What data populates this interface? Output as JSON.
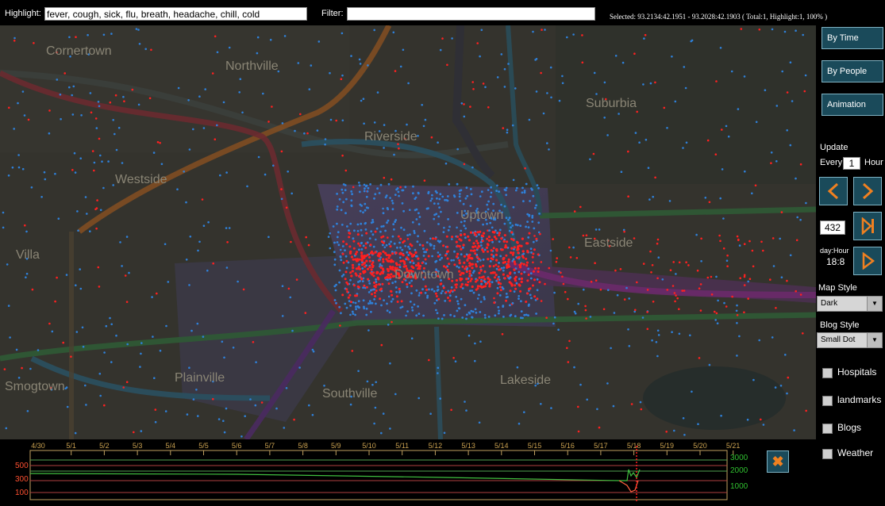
{
  "toolbar": {
    "highlight_label": "Highlight:",
    "highlight_value": "fever, cough, sick, flu, breath, headache, chill, cold",
    "filter_label": "Filter:",
    "filter_value": "",
    "selected_text": "Selected: 93.2134:42.1951 - 93.2028:42.1903 ( Total:1, Highlight:1, 100% )"
  },
  "map": {
    "areas": [
      "Cornertown",
      "Northville",
      "Suburbia",
      "Riverside",
      "Westside",
      "Uptown",
      "Eastside",
      "Villa",
      "Downtown",
      "Plainville",
      "Southville",
      "Lakeside",
      "Smogtown"
    ]
  },
  "side": {
    "by_time": "By Time",
    "by_people": "By People",
    "animation": "Animation",
    "update_label": "Update",
    "every_label": "Every",
    "every_value": "1",
    "hour_label": "Hour",
    "counter_value": "432",
    "day_hour_label": "day:Hour",
    "day_hour_value": "18:8",
    "map_style_label": "Map Style",
    "map_style_value": "Dark",
    "blog_style_label": "Blog Style",
    "blog_style_value": "Small Dot",
    "layers": [
      "Hospitals",
      "landmarks",
      "Blogs",
      "Weather"
    ]
  },
  "timeline": {
    "dates": [
      "4/30",
      "5/1",
      "5/2",
      "5/3",
      "5/4",
      "5/5",
      "5/6",
      "5/7",
      "5/8",
      "5/9",
      "5/10",
      "5/11",
      "5/12",
      "5/13",
      "5/14",
      "5/15",
      "5/16",
      "5/17",
      "5/18",
      "5/19",
      "5/20",
      "5/21"
    ],
    "left_ticks": [
      "500",
      "300",
      "100"
    ],
    "right_ticks": [
      "3000",
      "2000",
      "1000"
    ]
  },
  "colors": {
    "highlight_dot": "#ff2020",
    "normal_dot": "#2f80d8",
    "date_text": "#c8a050",
    "left_axis": "#ff5030",
    "right_axis": "#30c030"
  }
}
